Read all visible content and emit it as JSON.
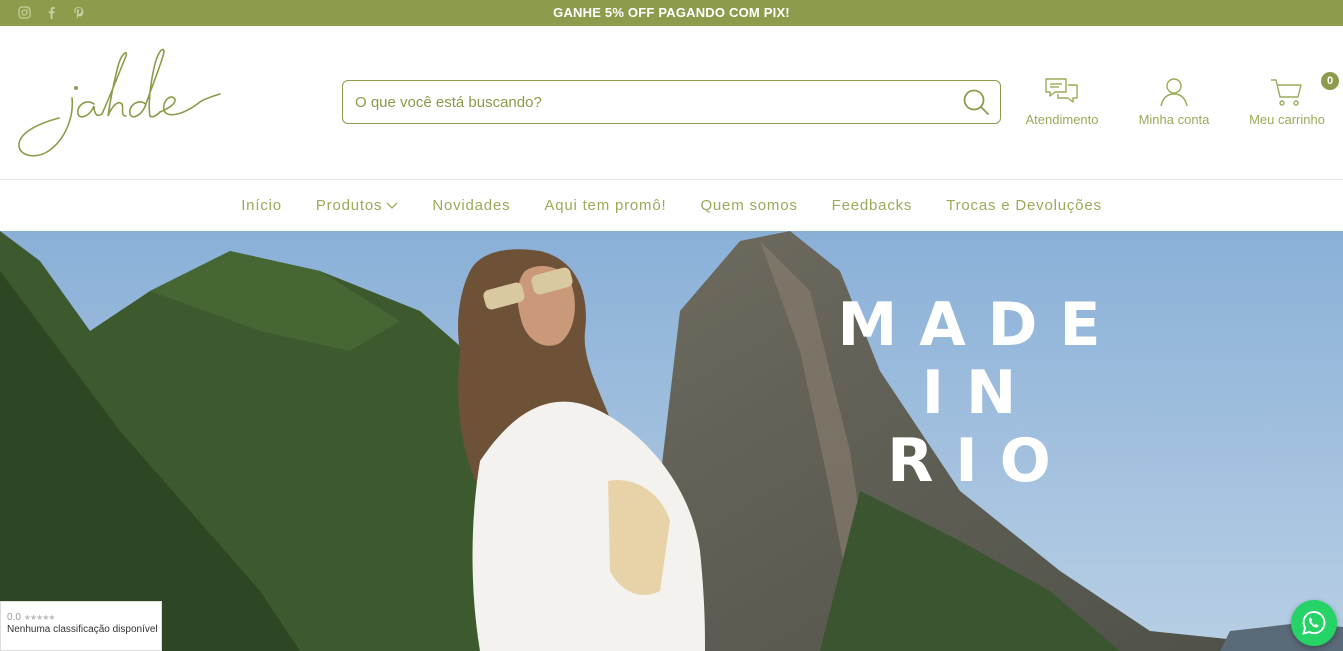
{
  "topbar": {
    "promo": "GANHE 5% OFF PAGANDO COM PIX!",
    "socials": [
      "instagram-icon",
      "facebook-icon",
      "pinterest-icon"
    ]
  },
  "header": {
    "logo_text": "jahde",
    "search": {
      "placeholder": "O que você está buscando?",
      "value": ""
    },
    "atendimento_label": "Atendimento",
    "conta_label": "Minha conta",
    "cart_label": "Meu carrinho",
    "cart_count": "0"
  },
  "nav": {
    "items": [
      {
        "label": "Início"
      },
      {
        "label": "Produtos"
      },
      {
        "label": "Novidades"
      },
      {
        "label": "Aqui tem promô!"
      },
      {
        "label": "Quem somos"
      },
      {
        "label": "Feedbacks"
      },
      {
        "label": "Trocas e Devoluções"
      }
    ]
  },
  "hero": {
    "line1": "MADE",
    "line2": "IN",
    "line3": "RIO"
  },
  "rating": {
    "score": "0.0",
    "stars": "★★★★★",
    "text": "Nenhuma classificação disponível"
  },
  "colors": {
    "brand": "#8c9c4c",
    "whatsapp": "#25d366"
  }
}
